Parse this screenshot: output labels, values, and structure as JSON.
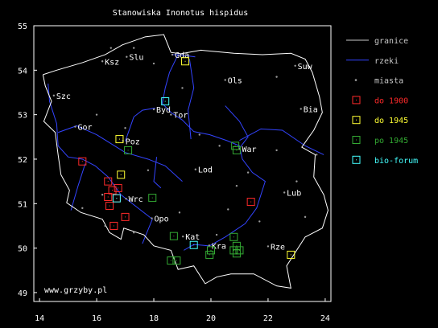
{
  "title": "Stanowiska Inonotus hispidus",
  "footer": "www.grzyby.pl",
  "axes": {
    "xlim": [
      13.8,
      24.2
    ],
    "ylim": [
      48.8,
      55.0
    ],
    "xticks": [
      "14",
      "16",
      "18",
      "20",
      "22",
      "24"
    ],
    "yticks": [
      "49",
      "50",
      "51",
      "52",
      "53",
      "54",
      "55"
    ]
  },
  "colors": {
    "background": "#000000",
    "frame": "#ffffff",
    "border": "#ffffff",
    "rivers": "#3344ff",
    "cities": "#999999",
    "do_1900": "#ff2a2a",
    "do_1945": "#ffff33",
    "po_1945": "#33aa33",
    "bio_forum": "#44ffff"
  },
  "legend": {
    "placement": "right",
    "items": [
      {
        "key": "border",
        "label": "granice",
        "symbol": "line",
        "color": "#c8c8c8"
      },
      {
        "key": "rivers",
        "label": "rzeki",
        "symbol": "line",
        "color": "#3344ff"
      },
      {
        "key": "cities",
        "label": "miasta",
        "symbol": "dot",
        "color": "#999999"
      },
      {
        "key": "do_1900",
        "label": "do 1900",
        "symbol": "square",
        "color": "#ff2a2a"
      },
      {
        "key": "do_1945",
        "label": "do 1945",
        "symbol": "square",
        "color": "#ffff33"
      },
      {
        "key": "po_1945",
        "label": "po 1945",
        "symbol": "square",
        "color": "#33aa33"
      },
      {
        "key": "bio_forum",
        "label": "bio-forum",
        "symbol": "square",
        "color": "#44ffff"
      }
    ]
  },
  "cities": [
    {
      "label": "Gda",
      "lon": 18.65,
      "lat": 54.35
    },
    {
      "label": "Ksz",
      "lon": 16.2,
      "lat": 54.2
    },
    {
      "label": "Slu",
      "lon": 17.05,
      "lat": 54.3
    },
    {
      "label": "Suw",
      "lon": 22.95,
      "lat": 54.1
    },
    {
      "label": "Ols",
      "lon": 20.5,
      "lat": 53.78
    },
    {
      "label": "Szc",
      "lon": 14.5,
      "lat": 53.43
    },
    {
      "label": "Byd",
      "lon": 18.0,
      "lat": 53.12
    },
    {
      "label": "Tor",
      "lon": 18.6,
      "lat": 53.0
    },
    {
      "label": "Bia",
      "lon": 23.15,
      "lat": 53.13
    },
    {
      "label": "Gor",
      "lon": 15.25,
      "lat": 52.73
    },
    {
      "label": "Poz",
      "lon": 16.92,
      "lat": 52.41
    },
    {
      "label": "War",
      "lon": 21.0,
      "lat": 52.23
    },
    {
      "label": "Lod",
      "lon": 19.46,
      "lat": 51.77
    },
    {
      "label": "Wrc",
      "lon": 17.03,
      "lat": 51.11
    },
    {
      "label": "Lub",
      "lon": 22.57,
      "lat": 51.25
    },
    {
      "label": "Opo",
      "lon": 17.93,
      "lat": 50.67
    },
    {
      "label": "Kat",
      "lon": 19.02,
      "lat": 50.26
    },
    {
      "label": "Kra",
      "lon": 19.94,
      "lat": 50.06
    },
    {
      "label": "Rze",
      "lon": 22.0,
      "lat": 50.04
    }
  ],
  "minor_towns": [
    {
      "lon": 16.5,
      "lat": 54.5
    },
    {
      "lon": 17.3,
      "lat": 54.5
    },
    {
      "lon": 18.0,
      "lat": 54.15
    },
    {
      "lon": 22.3,
      "lat": 53.85
    },
    {
      "lon": 19.0,
      "lat": 53.6
    },
    {
      "lon": 16.0,
      "lat": 53.0
    },
    {
      "lon": 17.0,
      "lat": 52.7
    },
    {
      "lon": 19.6,
      "lat": 52.55
    },
    {
      "lon": 20.3,
      "lat": 52.3
    },
    {
      "lon": 22.3,
      "lat": 52.2
    },
    {
      "lon": 23.7,
      "lat": 52.1
    },
    {
      "lon": 17.8,
      "lat": 51.75
    },
    {
      "lon": 21.3,
      "lat": 51.7
    },
    {
      "lon": 20.9,
      "lat": 51.4
    },
    {
      "lon": 16.2,
      "lat": 51.2
    },
    {
      "lon": 18.9,
      "lat": 50.8
    },
    {
      "lon": 20.6,
      "lat": 50.87
    },
    {
      "lon": 21.7,
      "lat": 50.6
    },
    {
      "lon": 15.5,
      "lat": 50.9
    },
    {
      "lon": 16.3,
      "lat": 50.5
    },
    {
      "lon": 17.3,
      "lat": 50.35
    },
    {
      "lon": 23.3,
      "lat": 50.7
    },
    {
      "lon": 20.2,
      "lat": 50.3
    },
    {
      "lon": 23.0,
      "lat": 51.5
    }
  ],
  "sites": [
    {
      "period": "do_1900",
      "lon": 15.5,
      "lat": 51.95
    },
    {
      "period": "do_1900",
      "lon": 16.4,
      "lat": 51.5
    },
    {
      "period": "do_1900",
      "lon": 16.55,
      "lat": 51.3
    },
    {
      "period": "do_1900",
      "lon": 16.4,
      "lat": 51.15
    },
    {
      "period": "do_1900",
      "lon": 16.75,
      "lat": 51.35
    },
    {
      "period": "do_1900",
      "lon": 16.7,
      "lat": 51.12
    },
    {
      "period": "do_1900",
      "lon": 16.45,
      "lat": 50.95
    },
    {
      "period": "do_1900",
      "lon": 17.0,
      "lat": 50.7
    },
    {
      "period": "do_1900",
      "lon": 16.6,
      "lat": 50.5
    },
    {
      "period": "do_1900",
      "lon": 21.4,
      "lat": 51.04
    },
    {
      "period": "do_1945",
      "lon": 19.1,
      "lat": 54.2
    },
    {
      "period": "do_1945",
      "lon": 16.8,
      "lat": 52.45
    },
    {
      "period": "do_1945",
      "lon": 16.85,
      "lat": 51.65
    },
    {
      "period": "do_1945",
      "lon": 22.8,
      "lat": 49.85
    },
    {
      "period": "po_1945",
      "lon": 17.1,
      "lat": 52.2
    },
    {
      "period": "po_1945",
      "lon": 20.85,
      "lat": 52.3
    },
    {
      "period": "po_1945",
      "lon": 20.9,
      "lat": 52.2
    },
    {
      "period": "po_1945",
      "lon": 17.95,
      "lat": 51.13
    },
    {
      "period": "po_1945",
      "lon": 18.7,
      "lat": 50.27
    },
    {
      "period": "po_1945",
      "lon": 18.6,
      "lat": 49.72
    },
    {
      "period": "po_1945",
      "lon": 18.8,
      "lat": 49.72
    },
    {
      "period": "po_1945",
      "lon": 20.0,
      "lat": 49.95
    },
    {
      "period": "po_1945",
      "lon": 19.95,
      "lat": 49.85
    },
    {
      "period": "po_1945",
      "lon": 20.8,
      "lat": 50.25
    },
    {
      "period": "po_1945",
      "lon": 20.9,
      "lat": 50.05
    },
    {
      "period": "po_1945",
      "lon": 20.8,
      "lat": 49.95
    },
    {
      "period": "po_1945",
      "lon": 21.0,
      "lat": 49.95
    },
    {
      "period": "po_1945",
      "lon": 20.9,
      "lat": 49.88
    },
    {
      "period": "bio_forum",
      "lon": 18.4,
      "lat": 53.3
    },
    {
      "period": "bio_forum",
      "lon": 16.7,
      "lat": 51.12
    },
    {
      "period": "bio_forum",
      "lon": 19.4,
      "lat": 50.07
    }
  ],
  "border": [
    [
      14.12,
      53.9
    ],
    [
      14.6,
      54.0
    ],
    [
      15.5,
      54.17
    ],
    [
      16.3,
      54.35
    ],
    [
      16.9,
      54.57
    ],
    [
      17.7,
      54.75
    ],
    [
      18.35,
      54.8
    ],
    [
      18.6,
      54.4
    ],
    [
      18.95,
      54.37
    ],
    [
      19.65,
      54.45
    ],
    [
      20.8,
      54.38
    ],
    [
      21.8,
      54.35
    ],
    [
      22.8,
      54.38
    ],
    [
      23.3,
      54.25
    ],
    [
      23.55,
      53.95
    ],
    [
      23.8,
      53.4
    ],
    [
      23.9,
      53.05
    ],
    [
      23.6,
      52.65
    ],
    [
      23.18,
      52.27
    ],
    [
      23.65,
      52.1
    ],
    [
      23.6,
      51.6
    ],
    [
      23.95,
      51.2
    ],
    [
      24.1,
      50.85
    ],
    [
      23.9,
      50.45
    ],
    [
      23.3,
      50.25
    ],
    [
      22.65,
      49.6
    ],
    [
      22.8,
      49.1
    ],
    [
      22.3,
      49.15
    ],
    [
      21.5,
      49.42
    ],
    [
      20.7,
      49.42
    ],
    [
      20.2,
      49.35
    ],
    [
      19.8,
      49.2
    ],
    [
      19.4,
      49.6
    ],
    [
      18.85,
      49.52
    ],
    [
      18.6,
      49.95
    ],
    [
      18.0,
      50.05
    ],
    [
      17.65,
      50.3
    ],
    [
      16.95,
      50.45
    ],
    [
      16.85,
      50.2
    ],
    [
      16.45,
      50.35
    ],
    [
      16.2,
      50.65
    ],
    [
      15.45,
      50.8
    ],
    [
      14.95,
      51.02
    ],
    [
      15.05,
      51.3
    ],
    [
      14.75,
      51.65
    ],
    [
      14.65,
      52.1
    ],
    [
      14.55,
      52.6
    ],
    [
      14.15,
      52.85
    ],
    [
      14.42,
      53.3
    ],
    [
      14.2,
      53.65
    ],
    [
      14.12,
      53.9
    ]
  ],
  "rivers": [
    [
      [
        19.05,
        49.95
      ],
      [
        19.4,
        50.08
      ],
      [
        19.95,
        50.05
      ],
      [
        20.5,
        50.25
      ],
      [
        21.2,
        50.55
      ],
      [
        21.6,
        50.9
      ],
      [
        21.9,
        51.5
      ],
      [
        21.45,
        51.7
      ],
      [
        21.1,
        52.0
      ],
      [
        21.0,
        52.3
      ],
      [
        20.55,
        52.42
      ],
      [
        19.95,
        52.55
      ],
      [
        19.4,
        52.62
      ],
      [
        19.0,
        52.88
      ],
      [
        18.6,
        53.05
      ],
      [
        18.3,
        53.25
      ],
      [
        18.4,
        53.6
      ],
      [
        18.55,
        53.95
      ],
      [
        18.85,
        54.35
      ]
    ],
    [
      [
        23.95,
        52.1
      ],
      [
        23.3,
        52.3
      ],
      [
        22.5,
        52.65
      ],
      [
        21.75,
        52.68
      ],
      [
        21.0,
        52.42
      ]
    ],
    [
      [
        20.5,
        53.2
      ],
      [
        21.0,
        52.85
      ],
      [
        21.3,
        52.5
      ],
      [
        21.0,
        52.25
      ]
    ],
    [
      [
        17.6,
        50.1
      ],
      [
        17.95,
        50.65
      ],
      [
        17.25,
        51.0
      ],
      [
        16.85,
        51.2
      ],
      [
        16.4,
        51.6
      ],
      [
        15.95,
        51.85
      ],
      [
        15.5,
        52.0
      ],
      [
        15.0,
        52.05
      ],
      [
        14.65,
        52.3
      ],
      [
        14.6,
        52.8
      ],
      [
        14.35,
        53.3
      ],
      [
        14.3,
        53.7
      ]
    ],
    [
      [
        19.0,
        51.5
      ],
      [
        18.4,
        51.85
      ],
      [
        17.8,
        52.0
      ],
      [
        17.0,
        52.15
      ],
      [
        16.0,
        52.55
      ],
      [
        15.3,
        52.75
      ],
      [
        14.65,
        52.6
      ]
    ],
    [
      [
        17.0,
        52.4
      ],
      [
        17.3,
        52.95
      ],
      [
        17.6,
        53.1
      ],
      [
        18.05,
        53.15
      ]
    ],
    [
      [
        19.3,
        52.45
      ],
      [
        19.2,
        53.1
      ],
      [
        19.4,
        53.6
      ],
      [
        19.25,
        54.25
      ]
    ],
    [
      [
        18.65,
        54.35
      ],
      [
        18.85,
        54.35
      ],
      [
        19.45,
        54.3
      ]
    ],
    [
      [
        18.1,
        52.05
      ],
      [
        18.0,
        51.5
      ],
      [
        18.25,
        51.35
      ]
    ],
    [
      [
        15.1,
        50.85
      ],
      [
        15.35,
        51.4
      ],
      [
        15.6,
        51.9
      ]
    ]
  ]
}
